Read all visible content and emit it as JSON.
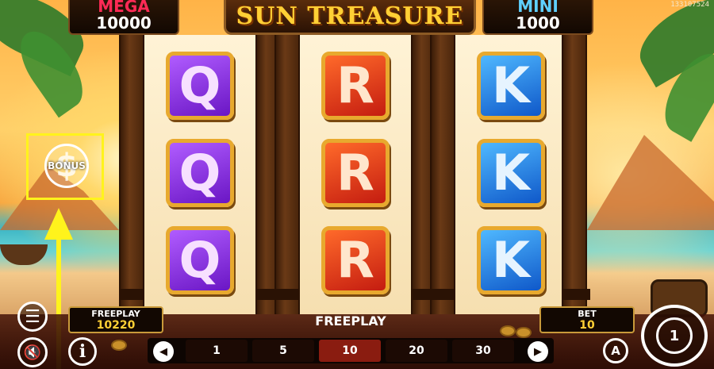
{
  "game_id": "133107524",
  "title": "SUN TREASURE",
  "jackpots": {
    "mega": {
      "label": "MEGA",
      "value": "10000"
    },
    "mini": {
      "label": "MINI",
      "value": "1000"
    }
  },
  "reels": [
    [
      "Q",
      "Q",
      "Q"
    ],
    [
      "R",
      "R",
      "R"
    ],
    [
      "K",
      "K",
      "K"
    ]
  ],
  "bonus": {
    "label": "BONUS",
    "icon": "dollar-coin-icon"
  },
  "status_text": "FREEPLAY",
  "freeplay": {
    "label": "FREEPLAY",
    "value": "10220"
  },
  "bet": {
    "label": "BET",
    "value": "10"
  },
  "bet_options": [
    "1",
    "5",
    "10",
    "20",
    "30"
  ],
  "selected_bet": "10",
  "controls": {
    "menu_icon": "hamburger-menu-icon",
    "sound_icon": "sound-muted-icon",
    "info_glyph": "i",
    "auto_glyph": "A",
    "spin_glyph": "1"
  },
  "colors": {
    "highlight": "#fff31c",
    "mega": "#ff2a56",
    "mini": "#5fd0ff",
    "title": "#ffd035",
    "selected_bet": "#8a1c10"
  }
}
